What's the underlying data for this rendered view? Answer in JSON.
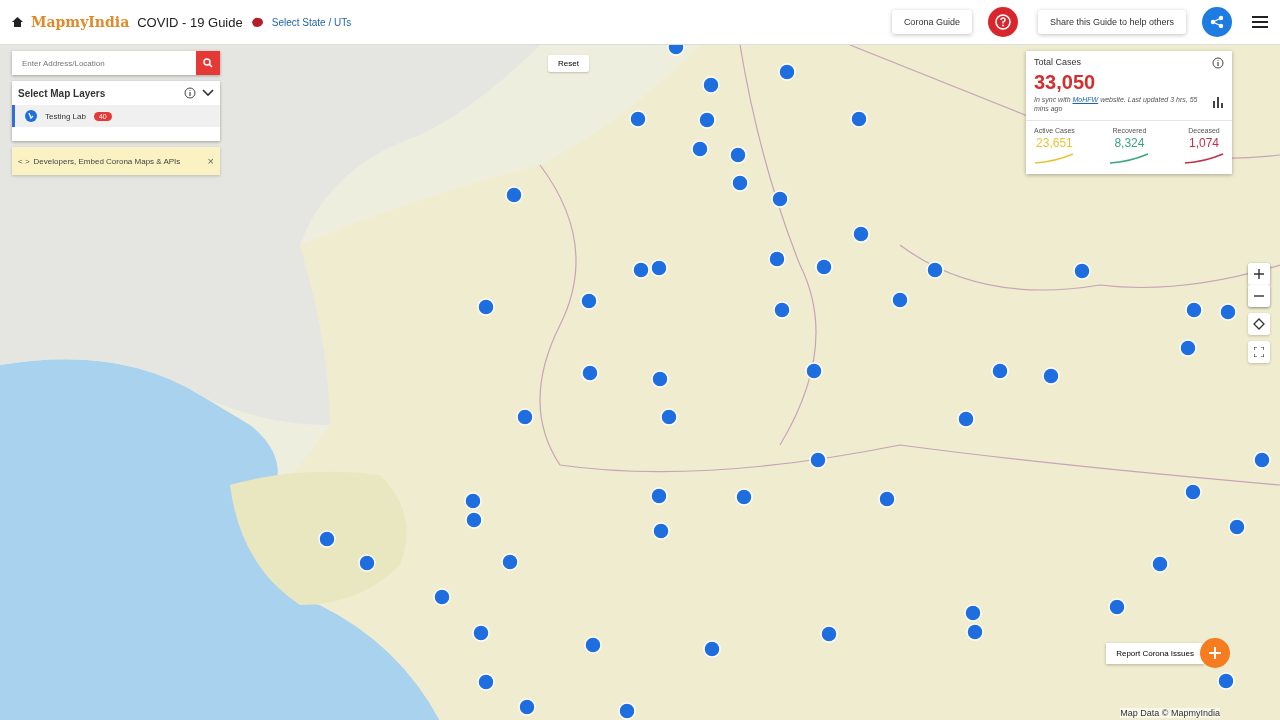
{
  "header": {
    "logo": "MapmyIndia",
    "title": "COVID - 19 Guide",
    "state_link": "Select State / UTs",
    "guide_button": "Corona Guide",
    "share_button": "Share this Guide to help others"
  },
  "search": {
    "placeholder": "Enter Address/Location"
  },
  "layers": {
    "title": "Select Map Layers",
    "expanded": true,
    "items": [
      {
        "label": "Testing Lab",
        "badge": "40",
        "selected": true
      }
    ]
  },
  "developer_banner": {
    "icon": "< >",
    "text": "Developers, Embed Corona Maps & APIs",
    "close": "×"
  },
  "map": {
    "reset": "Reset",
    "report_button": "Report Corona Issues",
    "attribution": "Map Data © MapmyIndia"
  },
  "stats": {
    "title": "Total Cases",
    "total": "33,050",
    "note_before": "In sync with ",
    "note_link": "MoHFW",
    "note_after": " website. Last updated 3 hrs, 55 mins ago",
    "items": [
      {
        "label": "Active Cases",
        "value": "23,651",
        "color": "#e8c33a"
      },
      {
        "label": "Recovered",
        "value": "8,324",
        "color": "#3aa57a"
      },
      {
        "label": "Deceased",
        "value": "1,074",
        "color": "#c0304a"
      }
    ]
  }
}
